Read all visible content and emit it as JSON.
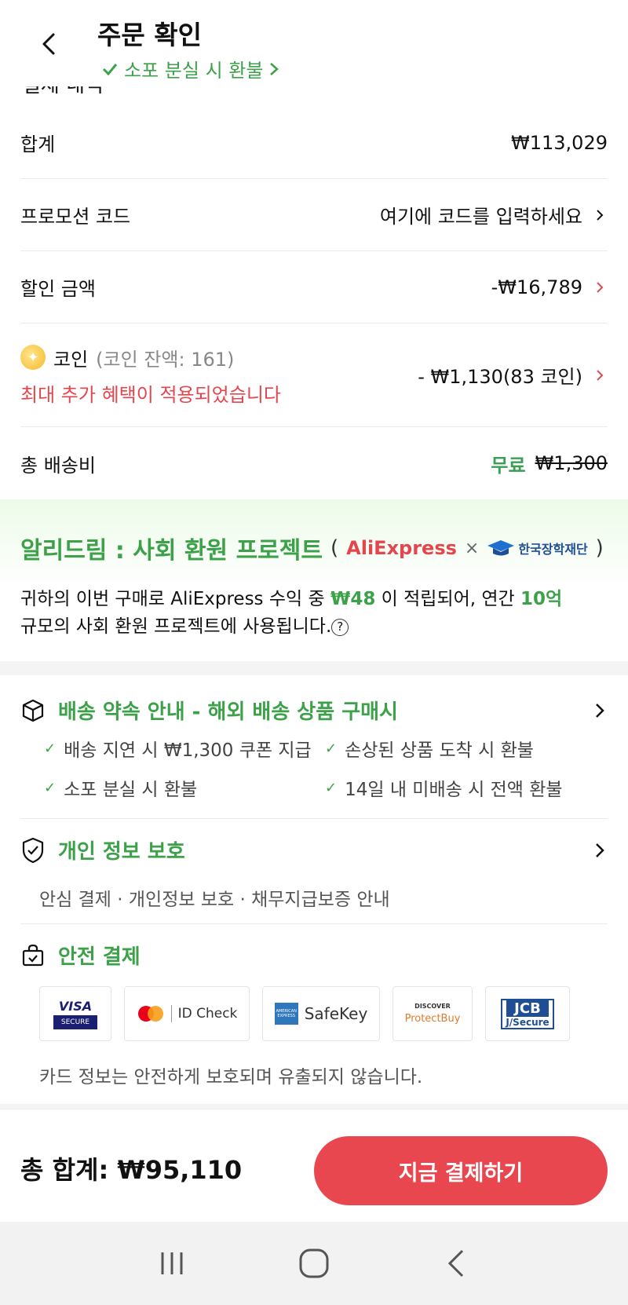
{
  "header": {
    "title": "주문 확인",
    "subtitle": "소포 분실 시 환불",
    "cut_text": "결제 내역"
  },
  "summary": {
    "subtotal_label": "합계",
    "subtotal_value": "₩113,029",
    "promo_label": "프로모션 코드",
    "promo_placeholder": "여기에 코드를 입력하세요",
    "discount_label": "할인 금액",
    "discount_value": "-₩16,789",
    "coin_label": "코인",
    "coin_balance": "(코인 잔액: 161)",
    "coin_note": "최대 추가 혜택이 적용되었습니다",
    "coin_value": "- ₩1,130(83 코인)",
    "shipping_label": "총 배송비",
    "shipping_free": "무료",
    "shipping_original": "₩1,300"
  },
  "dream": {
    "title": "알리드림 : 사회 환원 프로젝트",
    "paren_open": "(",
    "paren_close": ")",
    "ali_logo": "AliExpress",
    "times": "×",
    "ksf_logo": "한국장학재단",
    "body_1": "귀하의 이번 구매로 AliExpress 수익 중 ",
    "amount": "₩48",
    "body_2": " 이 적립되어, 연간 ",
    "annual": "10억",
    "body_3": "규모의 사회 환원 프로젝트에 사용됩니다.",
    "help": "?"
  },
  "delivery": {
    "title": "배송 약속 안내 - 해외 배송 상품 구매시",
    "items": [
      "배송 지연 시 ₩1,300 쿠폰 지급",
      "손상된 상품 도착 시 환불",
      "소포 분실 시 환불",
      "14일 내 미배송 시 전액 환불"
    ]
  },
  "privacy": {
    "title": "개인 정보 보호",
    "sub": "안심 결제 · 개인정보 보호 · 채무지급보증 안내"
  },
  "secure": {
    "title": "안전 결제",
    "logos": {
      "visa": "VISA",
      "visa_sub": "SECURE",
      "mc": "ID Check",
      "amex": "SafeKey",
      "amex_badge": "AMERICAN EXPRESS",
      "discover": "DISCOVER",
      "protectbuy": "ProtectBuy",
      "jcb": "JCB",
      "jcb_sub": "J/Secure"
    },
    "note": "카드 정보는 안전하게 보호되며 유출되지 않습니다."
  },
  "footer": {
    "total": "총 합계:  ₩95,110",
    "pay_button": "지금 결제하기"
  },
  "colors": {
    "green": "#3da14a",
    "red": "#e4464e",
    "button": "#e8474f"
  }
}
